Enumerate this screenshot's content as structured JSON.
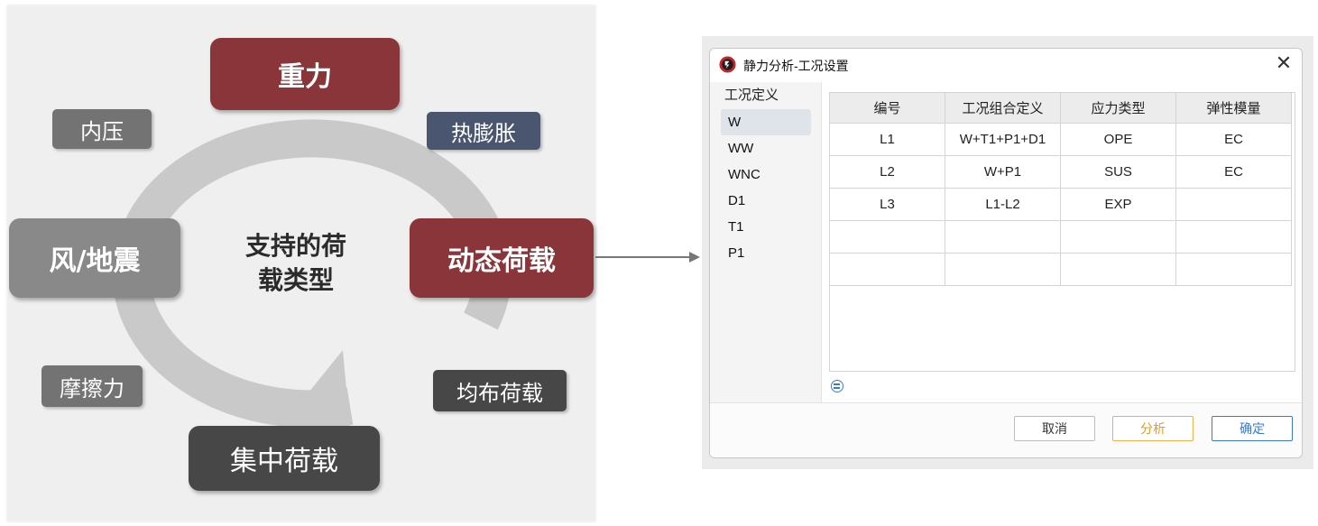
{
  "diagram": {
    "center_label_line1": "支持的荷",
    "center_label_line2": "载类型",
    "nodes": {
      "gravity": "重力",
      "internal_pressure": "内压",
      "thermal_expansion": "热膨胀",
      "wind_seismic": "风/地震",
      "dynamic_load": "动态荷载",
      "friction": "摩擦力",
      "distributed_load": "均布荷载",
      "concentrated_load": "集中荷载"
    },
    "colors": {
      "accent_red": "#8a3539",
      "dark_gray": "#474747",
      "mid_gray": "#737373",
      "light_gray": "#898989",
      "slate_blue": "#4a5670",
      "ring": "#c9c9c9"
    }
  },
  "dialog": {
    "title": "静力分析-工况设置",
    "close_symbol": "✕",
    "sidebar": {
      "header": "工况定义",
      "items": [
        "W",
        "WW",
        "WNC",
        "D1",
        "T1",
        "P1"
      ],
      "selected": "W"
    },
    "table": {
      "headers": [
        "编号",
        "工况组合定义",
        "应力类型",
        "弹性模量"
      ],
      "rows": [
        [
          "L1",
          "W+T1+P1+D1",
          "OPE",
          "EC"
        ],
        [
          "L2",
          "W+P1",
          "SUS",
          "EC"
        ],
        [
          "L3",
          "L1-L2",
          "EXP",
          ""
        ],
        [
          "",
          "",
          "",
          ""
        ],
        [
          "",
          "",
          "",
          ""
        ]
      ]
    },
    "buttons": {
      "cancel": "取消",
      "analyze": "分析",
      "ok": "确定"
    }
  }
}
